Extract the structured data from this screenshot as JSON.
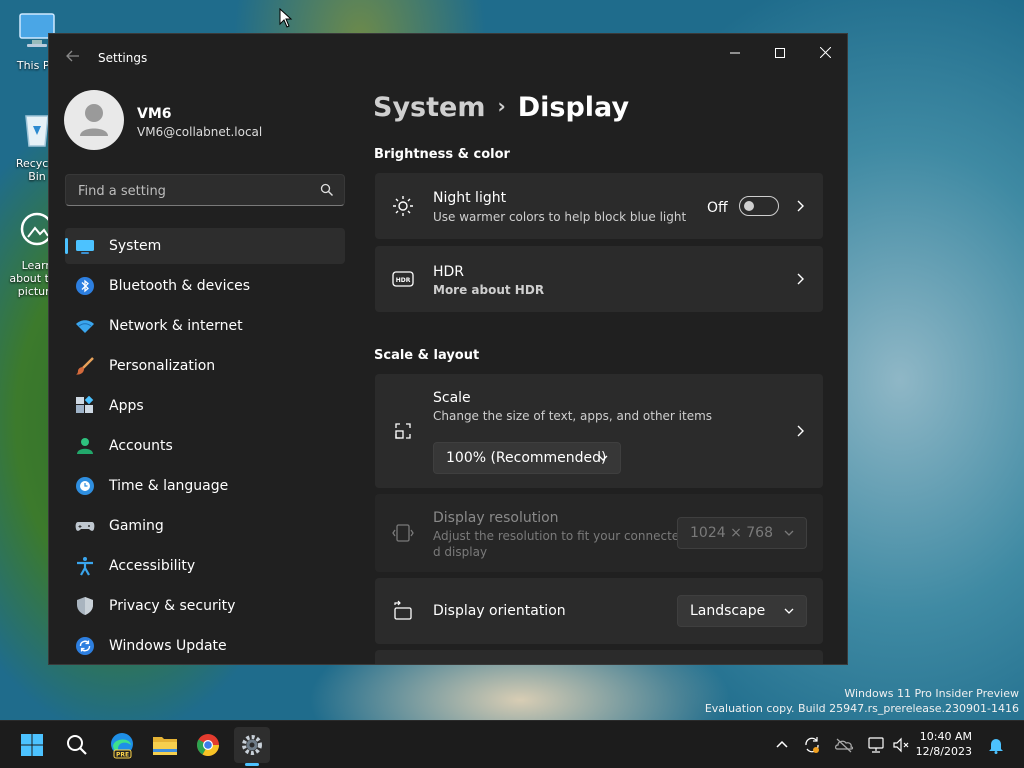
{
  "desktop": {
    "icons": [
      {
        "label": "This PC"
      },
      {
        "label": "Recycle Bin"
      },
      {
        "label": "Learn about this picture"
      }
    ],
    "watermark": {
      "line1": "Windows 11 Pro Insider Preview",
      "line2": "Evaluation copy. Build 25947.rs_prerelease.230901-1416"
    }
  },
  "window": {
    "title": "Settings",
    "controls": {
      "minimize": "—",
      "maximize": "☐",
      "close": "✕"
    }
  },
  "user": {
    "name": "VM6",
    "email": "VM6@collabnet.local"
  },
  "search": {
    "placeholder": "Find a setting"
  },
  "nav": [
    {
      "label": "System",
      "icon": "monitor-icon",
      "active": true
    },
    {
      "label": "Bluetooth & devices",
      "icon": "bluetooth-icon"
    },
    {
      "label": "Network & internet",
      "icon": "wifi-icon"
    },
    {
      "label": "Personalization",
      "icon": "paintbrush-icon"
    },
    {
      "label": "Apps",
      "icon": "apps-icon"
    },
    {
      "label": "Accounts",
      "icon": "person-icon"
    },
    {
      "label": "Time & language",
      "icon": "globe-clock-icon"
    },
    {
      "label": "Gaming",
      "icon": "controller-icon"
    },
    {
      "label": "Accessibility",
      "icon": "accessibility-icon"
    },
    {
      "label": "Privacy & security",
      "icon": "shield-icon"
    },
    {
      "label": "Windows Update",
      "icon": "update-icon"
    }
  ],
  "breadcrumb": {
    "parent": "System",
    "separator": "›",
    "current": "Display"
  },
  "sections": {
    "brightness": {
      "title": "Brightness & color",
      "night_light": {
        "title": "Night light",
        "subtitle": "Use warmer colors to help block blue light",
        "state": "Off"
      },
      "hdr": {
        "title": "HDR",
        "link": "More about HDR"
      }
    },
    "scale_layout": {
      "title": "Scale & layout",
      "scale": {
        "title": "Scale",
        "subtitle": "Change the size of text, apps, and other items",
        "value": "100% (Recommended)"
      },
      "resolution": {
        "title": "Display resolution",
        "subtitle_line1": "Adjust the resolution to fit your connecte",
        "subtitle_line2": "d display",
        "value": "1024 × 768"
      },
      "orientation": {
        "title": "Display orientation",
        "value": "Landscape"
      }
    }
  },
  "taskbar": {
    "apps": [
      "start-icon",
      "search-icon",
      "edge-icon",
      "file-explorer-icon",
      "chrome-icon",
      "settings-icon"
    ],
    "clock": {
      "time": "10:40 AM",
      "date": "12/8/2023"
    }
  },
  "colors": {
    "accent": "#4cc2ff",
    "link": "#6cc8ff",
    "window_bg": "#202020",
    "card_bg": "#2b2b2b"
  }
}
